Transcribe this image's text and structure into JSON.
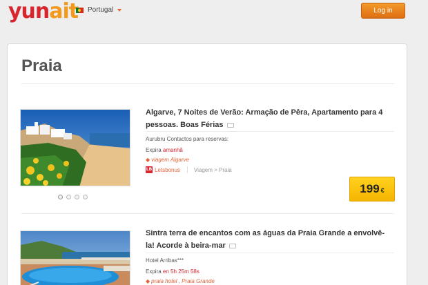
{
  "header": {
    "logo_part1": "yun",
    "logo_part2": "ait",
    "country": "Portugal",
    "login_label": "Log in"
  },
  "page_title": "Praia",
  "deals": [
    {
      "title": "Algarve, 7 Noites de Verão: Armação de Pêra, Apartamento para 4 pessoas. Boas Férias",
      "vendor": "Aurubru Contactos para reservas:",
      "expiry_prefix": "Expira",
      "expiry_value": "amanhã",
      "tags": "viagem Algarve",
      "source_name": "Letsbonus",
      "source_logo_text": "LB",
      "breadcrumb": "Viagem > Praia",
      "price": "199",
      "currency": "€"
    },
    {
      "title": "Sintra terra de encantos com as águas da Praia Grande a envolvê-la! Acorde à beira-mar",
      "vendor": "Hotel Arribas***",
      "expiry_prefix": "Expira",
      "expiry_value": "en 5h 25m 58s",
      "tags": "praia hotel , Praia Grande"
    }
  ],
  "colors": {
    "brand_red": "#d8262e",
    "brand_orange": "#f39a1e",
    "login_button": "#e4821c",
    "price_badge": "#ffc20e"
  },
  "icons": [
    "portugal-flag-icon",
    "chevron-down-icon",
    "comment-icon",
    "tag-icon"
  ]
}
